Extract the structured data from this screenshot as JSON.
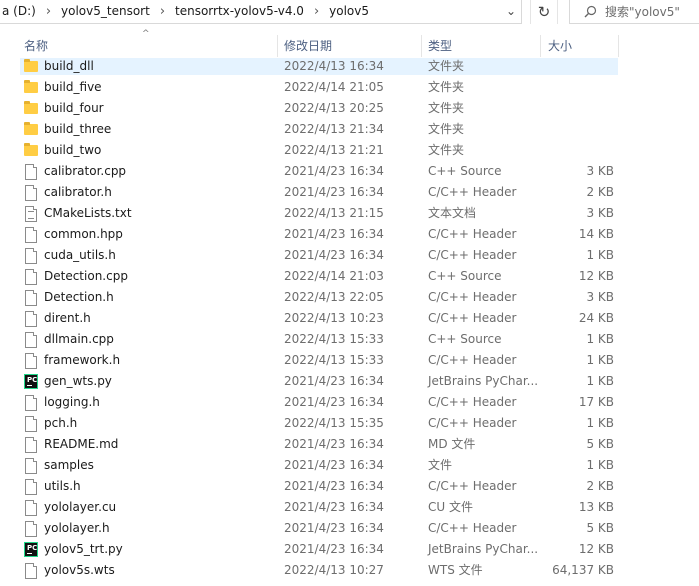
{
  "address": {
    "crumbs": [
      "a (D:)",
      "yolov5_tensort",
      "tensorrtx-yolov5-v4.0",
      "yolov5"
    ],
    "separator": "›",
    "dropdown_glyph": "⌄",
    "refresh_glyph": "↻"
  },
  "search": {
    "placeholder": "搜索\"yolov5\"",
    "icon": "search-icon"
  },
  "columns": {
    "name": "名称",
    "date": "修改日期",
    "type": "类型",
    "size": "大小",
    "sort_glyph": "^"
  },
  "files": [
    {
      "name": "build_dll",
      "date": "2022/4/13 16:34",
      "type": "文件夹",
      "size": "",
      "icon": "folder",
      "selected": true
    },
    {
      "name": "build_five",
      "date": "2022/4/14 21:05",
      "type": "文件夹",
      "size": "",
      "icon": "folder"
    },
    {
      "name": "build_four",
      "date": "2022/4/13 20:25",
      "type": "文件夹",
      "size": "",
      "icon": "folder"
    },
    {
      "name": "build_three",
      "date": "2022/4/13 21:34",
      "type": "文件夹",
      "size": "",
      "icon": "folder"
    },
    {
      "name": "build_two",
      "date": "2022/4/13 21:21",
      "type": "文件夹",
      "size": "",
      "icon": "folder"
    },
    {
      "name": "calibrator.cpp",
      "date": "2021/4/23 16:34",
      "type": "C++ Source",
      "size": "3 KB",
      "icon": "doc"
    },
    {
      "name": "calibrator.h",
      "date": "2021/4/23 16:34",
      "type": "C/C++ Header",
      "size": "2 KB",
      "icon": "doc"
    },
    {
      "name": "CMakeLists.txt",
      "date": "2022/4/13 21:15",
      "type": "文本文档",
      "size": "3 KB",
      "icon": "txt"
    },
    {
      "name": "common.hpp",
      "date": "2021/4/23 16:34",
      "type": "C/C++ Header",
      "size": "14 KB",
      "icon": "doc"
    },
    {
      "name": "cuda_utils.h",
      "date": "2021/4/23 16:34",
      "type": "C/C++ Header",
      "size": "1 KB",
      "icon": "doc"
    },
    {
      "name": "Detection.cpp",
      "date": "2022/4/14 21:03",
      "type": "C++ Source",
      "size": "12 KB",
      "icon": "doc"
    },
    {
      "name": "Detection.h",
      "date": "2022/4/13 22:05",
      "type": "C/C++ Header",
      "size": "3 KB",
      "icon": "doc"
    },
    {
      "name": "dirent.h",
      "date": "2022/4/13 10:23",
      "type": "C/C++ Header",
      "size": "24 KB",
      "icon": "doc"
    },
    {
      "name": "dllmain.cpp",
      "date": "2022/4/13 15:33",
      "type": "C++ Source",
      "size": "1 KB",
      "icon": "doc"
    },
    {
      "name": "framework.h",
      "date": "2022/4/13 15:33",
      "type": "C/C++ Header",
      "size": "1 KB",
      "icon": "doc"
    },
    {
      "name": "gen_wts.py",
      "date": "2021/4/23 16:34",
      "type": "JetBrains PyChar...",
      "size": "1 KB",
      "icon": "pycharm"
    },
    {
      "name": "logging.h",
      "date": "2021/4/23 16:34",
      "type": "C/C++ Header",
      "size": "17 KB",
      "icon": "doc"
    },
    {
      "name": "pch.h",
      "date": "2022/4/13 15:35",
      "type": "C/C++ Header",
      "size": "1 KB",
      "icon": "doc"
    },
    {
      "name": "README.md",
      "date": "2021/4/23 16:34",
      "type": "MD 文件",
      "size": "5 KB",
      "icon": "doc"
    },
    {
      "name": "samples",
      "date": "2021/4/23 16:34",
      "type": "文件",
      "size": "1 KB",
      "icon": "doc"
    },
    {
      "name": "utils.h",
      "date": "2021/4/23 16:34",
      "type": "C/C++ Header",
      "size": "2 KB",
      "icon": "doc"
    },
    {
      "name": "yololayer.cu",
      "date": "2021/4/23 16:34",
      "type": "CU 文件",
      "size": "13 KB",
      "icon": "doc"
    },
    {
      "name": "yololayer.h",
      "date": "2021/4/23 16:34",
      "type": "C/C++ Header",
      "size": "5 KB",
      "icon": "doc"
    },
    {
      "name": "yolov5_trt.py",
      "date": "2021/4/23 16:34",
      "type": "JetBrains PyChar...",
      "size": "12 KB",
      "icon": "pycharm"
    },
    {
      "name": "yolov5s.wts",
      "date": "2022/4/13 10:27",
      "type": "WTS 文件",
      "size": "64,137 KB",
      "icon": "doc"
    }
  ],
  "pycharm_label": "PC"
}
